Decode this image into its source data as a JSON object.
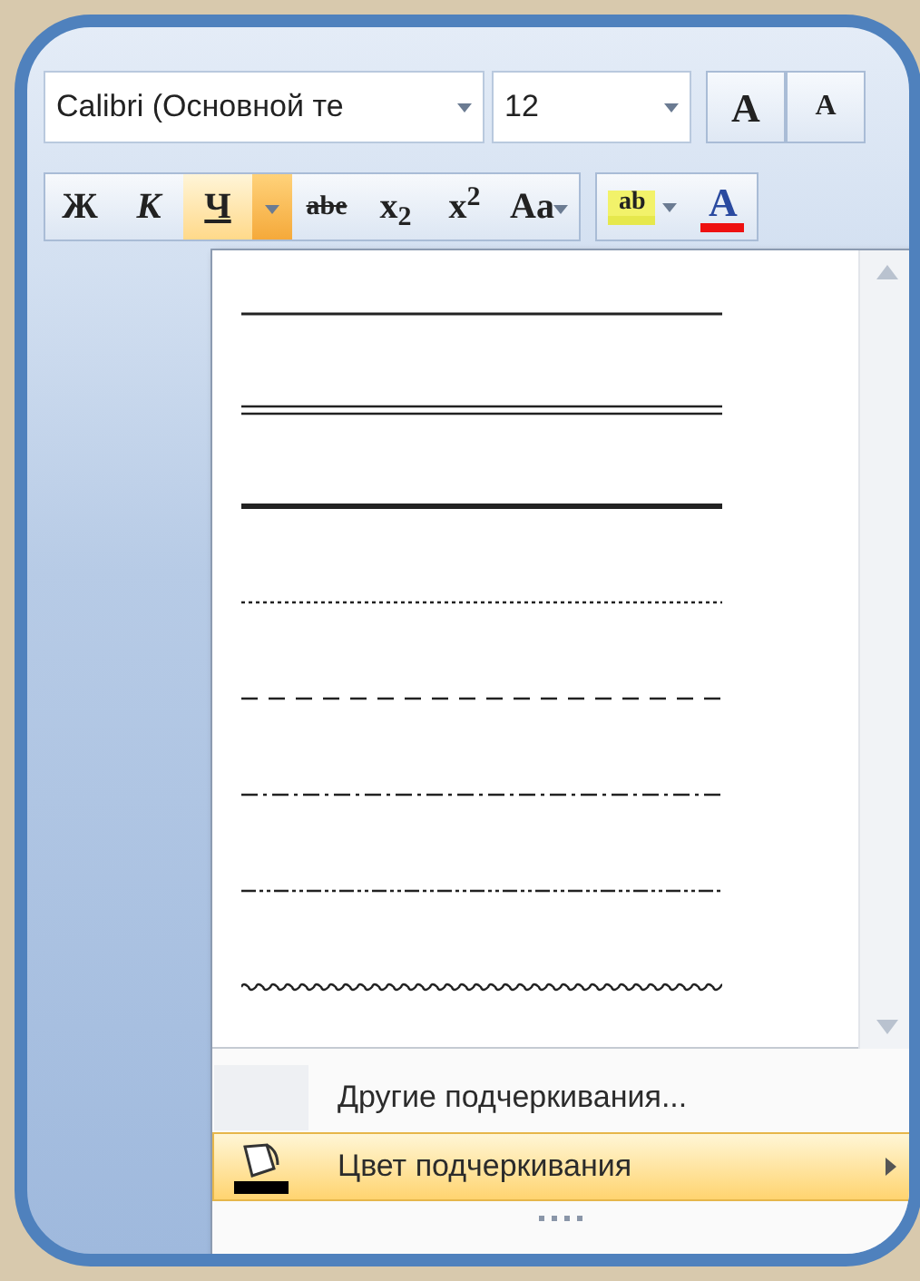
{
  "font_box": {
    "value": "Calibri (Основной те"
  },
  "size_box": {
    "value": "12"
  },
  "size_buttons": [
    {
      "kind": "grow",
      "label": "A"
    },
    {
      "kind": "shrink",
      "label": "A"
    }
  ],
  "format_buttons": [
    {
      "kind": "bold",
      "label": "Ж",
      "selected": false
    },
    {
      "kind": "italic",
      "label": "К",
      "selected": false
    },
    {
      "kind": "underline",
      "label": "Ч",
      "selected": true
    },
    {
      "kind": "arrow",
      "selected": true
    },
    {
      "kind": "strike",
      "label": "abe",
      "selected": false
    },
    {
      "kind": "script",
      "label": "x$_{2}$",
      "selected": false
    },
    {
      "kind": "script",
      "label": "x$^{2}$",
      "selected": false
    },
    {
      "kind": "case",
      "label": "Aa",
      "selected": false
    }
  ],
  "color_buttons": [
    {
      "kind": "highlight",
      "label": "ab",
      "color": "#e6e84c"
    },
    {
      "kind": "font_color",
      "label": "A",
      "color": "#ee1111"
    }
  ],
  "underline_styles": [
    {
      "kind": "single"
    },
    {
      "kind": "double"
    },
    {
      "kind": "thick"
    },
    {
      "kind": "dotted"
    },
    {
      "kind": "dashed"
    },
    {
      "kind": "dash-dot"
    },
    {
      "kind": "dash-dot-dot"
    },
    {
      "kind": "wave"
    }
  ],
  "menu_items": [
    {
      "kind": "plain",
      "label": "Другие подчеркивания...",
      "selected": false
    },
    {
      "kind": "submenu",
      "label": "Цвет подчеркивания",
      "selected": true
    }
  ]
}
